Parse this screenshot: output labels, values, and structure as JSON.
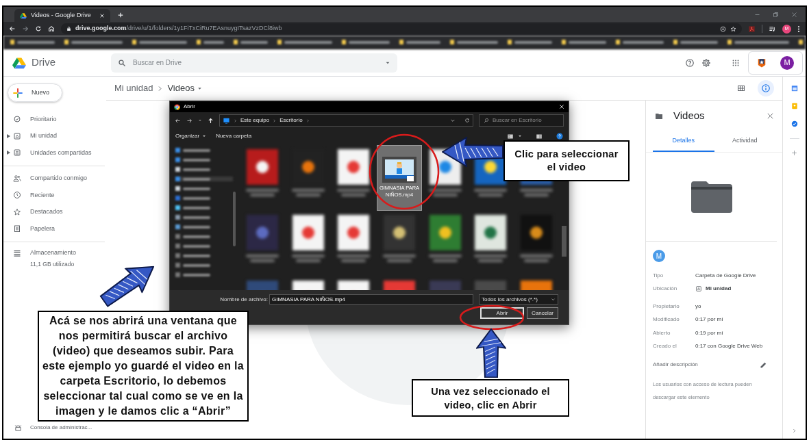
{
  "browser": {
    "tab_title": "Videos - Google Drive",
    "url_host": "drive.google.com",
    "url_path": "/drive/u/1/folders/1y1FiTxCiRu7EAsnuygITsazVzDCl8iwb",
    "profile_initial": "M"
  },
  "header": {
    "app_name": "Drive",
    "search_placeholder": "Buscar en Drive",
    "account_initial": "M"
  },
  "sidebar": {
    "new_button": "Nuevo",
    "sections": [
      {
        "items": [
          {
            "label": "Prioritario",
            "expandable": false
          },
          {
            "label": "Mi unidad",
            "expandable": true
          },
          {
            "label": "Unidades compartidas",
            "expandable": true
          }
        ]
      },
      {
        "items": [
          {
            "label": "Compartido conmigo",
            "expandable": false
          },
          {
            "label": "Reciente",
            "expandable": false
          },
          {
            "label": "Destacados",
            "expandable": false
          },
          {
            "label": "Papelera",
            "expandable": false
          }
        ]
      }
    ],
    "storage": {
      "label": "Almacenamiento",
      "usage": "11,1 GB utilizado"
    },
    "admin_console": "Consola de administrac..."
  },
  "breadcrumb": [
    "Mi unidad",
    "Videos"
  ],
  "view": {
    "details_active": true
  },
  "dialog": {
    "title": "Abrir",
    "path": [
      "Este equipo",
      "Escritorio"
    ],
    "search_placeholder": "Buscar en Escritorio",
    "toolbar": [
      "Organizar",
      "Nueva carpeta"
    ],
    "files": [
      {
        "name": "GIMNASIA PARA NIÑOS.mp4",
        "selected": true
      }
    ],
    "filename_label": "Nombre de archivo:",
    "filename_value": "GIMNASIA PARA NIÑOS.mp4",
    "filetype": "Todos los archivos (*.*)",
    "buttons": [
      "Abrir",
      "Cancelar"
    ]
  },
  "details": {
    "title": "Videos",
    "tabs": [
      {
        "label": "Detalles",
        "selected": true
      },
      {
        "label": "Actividad",
        "selected": false
      }
    ],
    "owner_initial": "M",
    "properties": [
      {
        "label": "Tipo",
        "value": "Carpeta de Google Drive",
        "kind": "text"
      },
      {
        "label": "Ubicación",
        "value": "Mi unidad",
        "kind": "location"
      },
      {
        "label": "Propietario",
        "value": "yo",
        "kind": "text"
      },
      {
        "label": "Modificado",
        "value": "0:17 por mí",
        "kind": "text"
      },
      {
        "label": "Abierto",
        "value": "0:19 por mí",
        "kind": "text"
      },
      {
        "label": "Creado el",
        "value": "0:17 con Google Drive Web",
        "kind": "text"
      }
    ],
    "add_description": "Añadir descripción",
    "note": "Los usuarios con acceso de lectura pueden descargar este elemento"
  },
  "callouts": [
    {
      "text": "Clic para seleccionar el video"
    },
    {
      "text": "Acá se nos abrirá una ventana que nos permitirá buscar el archivo (video) que deseamos subir. Para este ejemplo yo guardé el video en la carpeta Escritorio, lo debemos seleccionar tal cual como se ve en la imagen y le damos clic a “Abrir”"
    },
    {
      "text": "Una vez seleccionado el video, clic en Abrir"
    }
  ]
}
